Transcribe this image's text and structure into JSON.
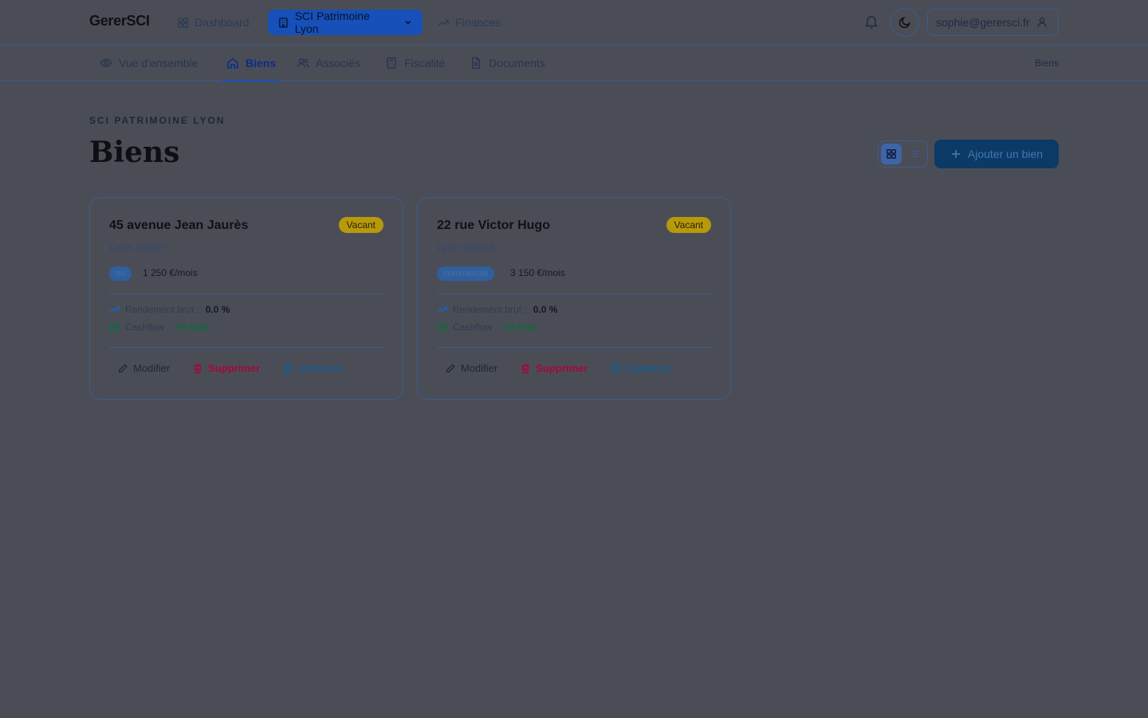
{
  "app": {
    "brand": "GererSCI"
  },
  "topnav": {
    "dashboard": "Dashboard",
    "current_sci": "SCI Patrimoine Lyon",
    "finances": "Finances"
  },
  "user": {
    "email": "sophie@gerersci.fr"
  },
  "subnav": {
    "tabs": [
      {
        "label": "Vue d'ensemble",
        "icon": "eye-icon"
      },
      {
        "label": "Biens",
        "icon": "home-icon",
        "active": true
      },
      {
        "label": "Associés",
        "icon": "users-icon"
      },
      {
        "label": "Fiscalité",
        "icon": "calculator-icon"
      },
      {
        "label": "Documents",
        "icon": "document-icon"
      }
    ],
    "breadcrumb": "Biens"
  },
  "page": {
    "overline": "SCI PATRIMOINE LYON",
    "title": "Biens",
    "add_button": "Ajouter un bien"
  },
  "properties": [
    {
      "address": "45 avenue Jean Jaurès",
      "city": "Lyon 69007",
      "status": "Vacant",
      "type": "nu",
      "rent": "1 250 €/mois",
      "yield_label": "Rendement brut :",
      "yield_value": "0.0 %",
      "cashflow_label": "Cashflow :",
      "cashflow_value": "+0 €/an",
      "actions": {
        "edit": "Modifier",
        "delete": "Supprimer",
        "receipt": "Quittance"
      }
    },
    {
      "address": "22 rue Victor Hugo",
      "city": "Lyon 69002",
      "status": "Vacant",
      "type": "commercial",
      "rent": "3 150 €/mois",
      "yield_label": "Rendement brut :",
      "yield_value": "0.0 %",
      "cashflow_label": "Cashflow :",
      "cashflow_value": "+0 €/an",
      "actions": {
        "edit": "Modifier",
        "delete": "Supprimer",
        "receipt": "Quittance"
      }
    }
  ],
  "colors": {
    "overlay_bg": "#4b4d56",
    "accent": "#1650b8",
    "status_badge": "#b79a0c",
    "danger": "#a3093c",
    "positive": "#0d6b3e"
  }
}
